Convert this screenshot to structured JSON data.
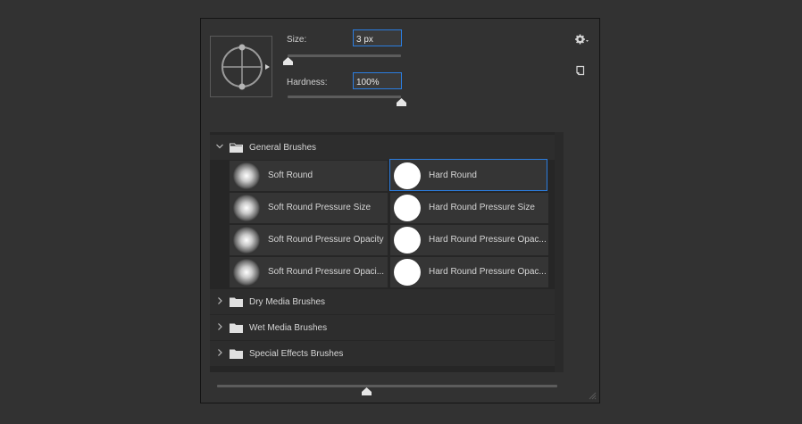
{
  "size": {
    "label": "Size:",
    "value": "3 px",
    "slider_fraction": 0.0
  },
  "hardness": {
    "label": "Hardness:",
    "value": "100%",
    "slider_fraction": 1.0
  },
  "icons": {
    "preview": "brush-tip-preview-icon",
    "gear": "gear-icon",
    "new_preset": "new-preset-icon",
    "folder": "folder-icon",
    "chevron_open": "chevron-down-icon",
    "chevron_closed": "chevron-right-icon"
  },
  "colors": {
    "accent": "#2b7de0",
    "panel_bg": "#323232",
    "list_bg": "#262626"
  },
  "groups": [
    {
      "name": "General Brushes",
      "expanded": true,
      "brushes": [
        {
          "name": "Soft Round",
          "tip": "soft",
          "selected": false
        },
        {
          "name": "Hard Round",
          "tip": "hard",
          "selected": true
        },
        {
          "name": "Soft Round Pressure Size",
          "tip": "soft",
          "selected": false
        },
        {
          "name": "Hard Round Pressure Size",
          "tip": "hard",
          "selected": false
        },
        {
          "name": "Soft Round Pressure Opacity",
          "tip": "soft",
          "selected": false
        },
        {
          "name": "Hard Round Pressure Opac...",
          "tip": "hard",
          "selected": false
        },
        {
          "name": "Soft Round Pressure Opaci...",
          "tip": "soft",
          "selected": false
        },
        {
          "name": "Hard Round Pressure Opac...",
          "tip": "hard",
          "selected": false
        }
      ]
    },
    {
      "name": "Dry Media Brushes",
      "expanded": false
    },
    {
      "name": "Wet Media Brushes",
      "expanded": false
    },
    {
      "name": "Special Effects Brushes",
      "expanded": false
    }
  ],
  "thumbnail_size_slider_fraction": 0.44
}
